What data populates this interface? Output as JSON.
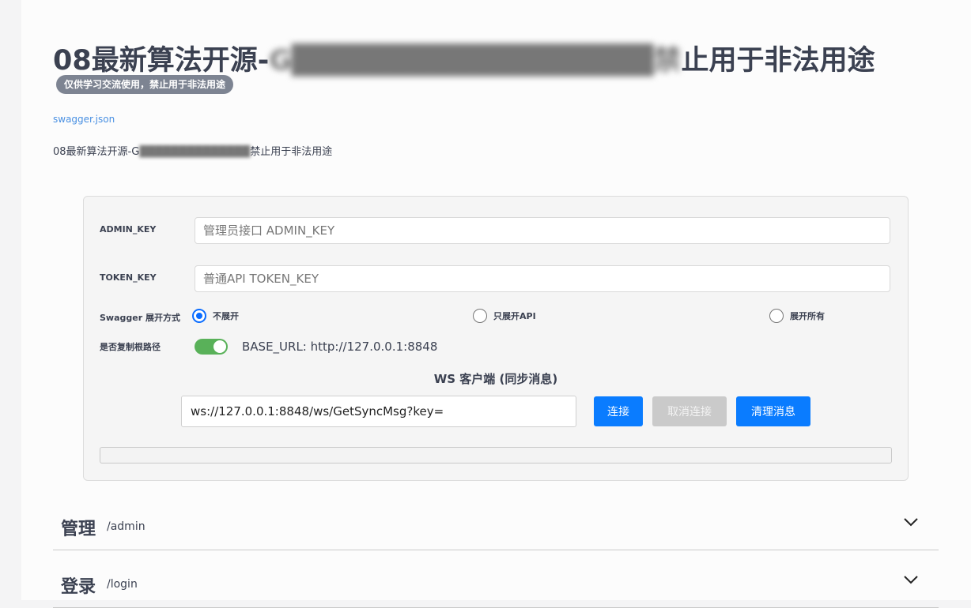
{
  "header": {
    "title_start": "08最新算法开源-",
    "title_blurred": "G█████████████████禁",
    "title_end": "止用于非法用途",
    "badge": "仅供学习交流使用，禁止用于非法用途",
    "swagger_link": "swagger.json",
    "description_start": "08最新算法开源-G",
    "description_blurred": "██████████████",
    "description_end": "禁止用于非法用途"
  },
  "panel": {
    "admin_key_label": "ADMIN_KEY",
    "admin_key_placeholder": "管理员接口 ADMIN_KEY",
    "admin_key_value": "",
    "token_key_label": "TOKEN_KEY",
    "token_key_placeholder": "普通API TOKEN_KEY",
    "token_key_value": "",
    "swagger_expand_label": "Swagger 展开方式",
    "expand_options": [
      "不展开",
      "只展开API",
      "展开所有"
    ],
    "expand_selected": "不展开",
    "copy_root_label": "是否复制根路径",
    "copy_root_on": true,
    "base_url": "BASE_URL: http://127.0.0.1:8848",
    "ws_title": "WS 客户端 (同步消息)",
    "ws_url": "ws://127.0.0.1:8848/ws/GetSyncMsg?key=",
    "connect_label": "连接",
    "disconnect_label": "取消连接",
    "clear_label": "清理消息"
  },
  "sections": [
    {
      "name": "管理",
      "path": "/admin"
    },
    {
      "name": "登录",
      "path": "/login"
    }
  ],
  "colors": {
    "primary": "#0a7cff",
    "toggle_on": "#59b159",
    "badge": "#7d8492",
    "link": "#4990e2",
    "disabled": "#cacaca"
  }
}
